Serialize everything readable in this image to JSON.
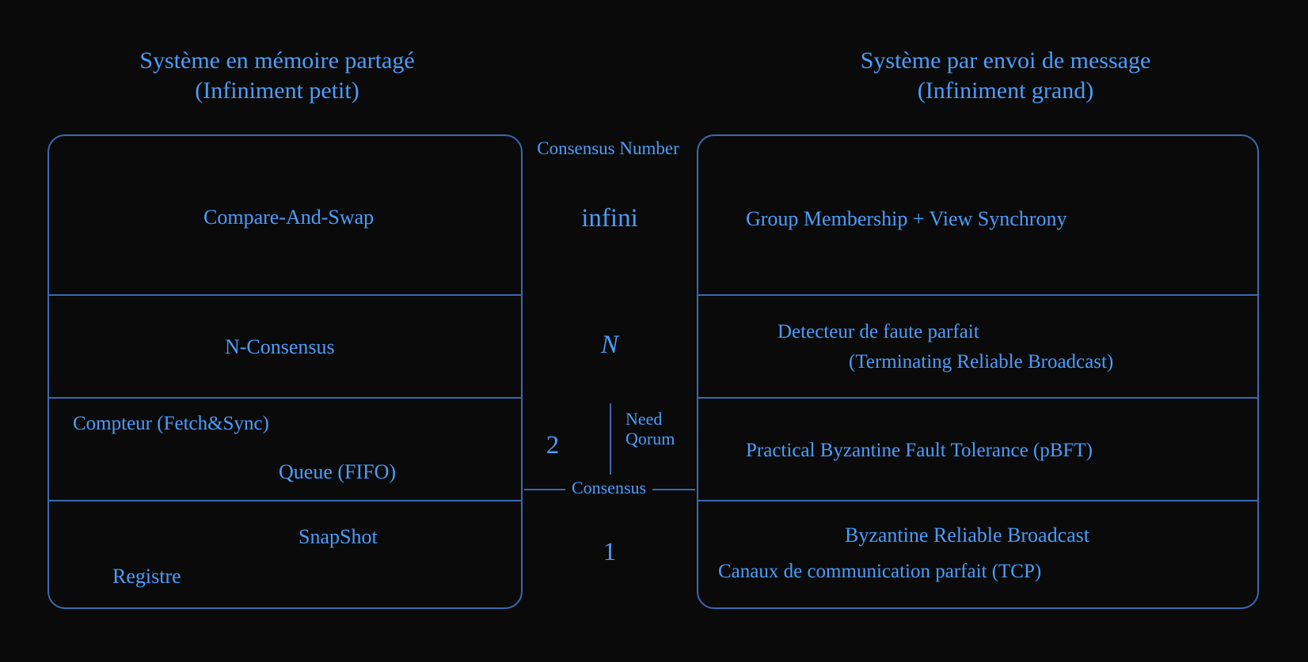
{
  "titles": {
    "left_line1": "Système en mémoire partagé",
    "left_line2": "(Infiniment petit)",
    "right_line1": "Système par envoi de message",
    "right_line2": "(Infiniment grand)"
  },
  "center": {
    "header": "Consensus Number",
    "infini": "infini",
    "N": "N",
    "two": "2",
    "one": "1",
    "need_qorum_line1": "Need",
    "need_qorum_line2": "Qorum",
    "consensus_word": "Consensus"
  },
  "left_box": {
    "r1": "Compare-And-Swap",
    "r2": "N-Consensus",
    "r3a": "Compteur (Fetch&Sync)",
    "r3b": "Queue (FIFO)",
    "r4a": "SnapShot",
    "r4b": "Registre"
  },
  "right_box": {
    "r1": "Group Membership + View Synchrony",
    "r2_line1": "Detecteur de faute parfait",
    "r2_line2": "(Terminating Reliable Broadcast)",
    "r3": "Practical Byzantine Fault Tolerance (pBFT)",
    "r4_line1": "Byzantine Reliable Broadcast",
    "r4_line2": "Canaux de communication parfait (TCP)"
  }
}
